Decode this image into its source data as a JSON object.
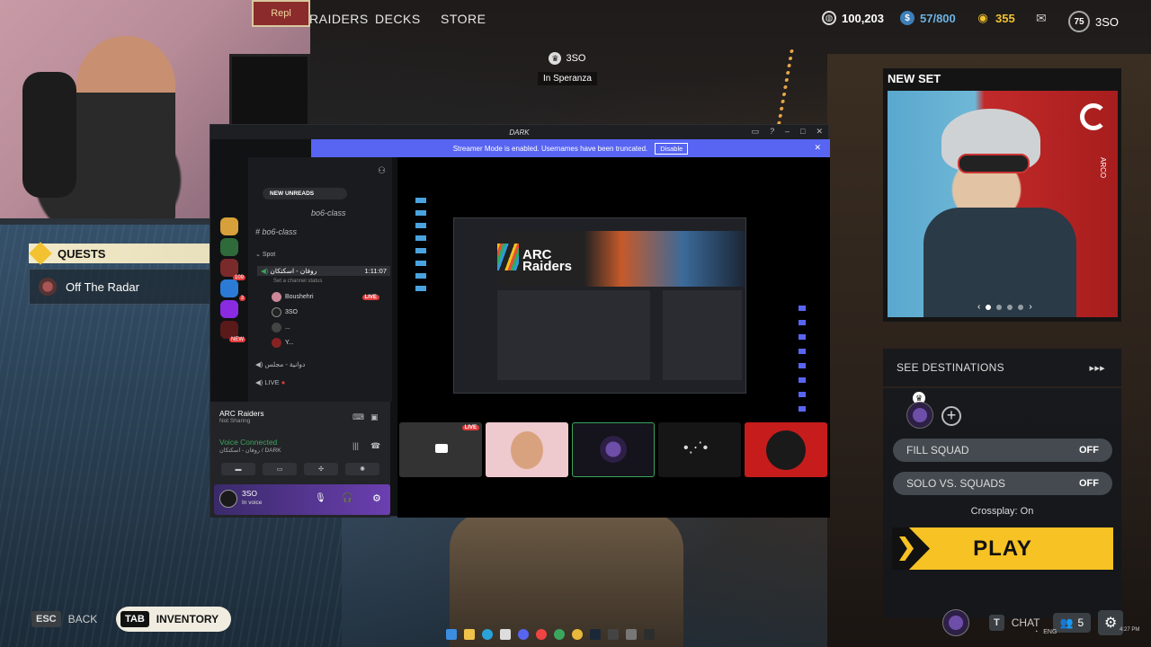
{
  "nav": {
    "items": [
      "RAIDERS",
      "DECKS",
      "STORE"
    ],
    "coins": "100,203",
    "cred": "57/800",
    "tokens": "355",
    "level": "75",
    "username": "3SO"
  },
  "webcam": {
    "sign_text": "Repl"
  },
  "quests": {
    "title": "QUESTS",
    "item": "Off The Radar"
  },
  "player_tag": {
    "name": "3SO",
    "location": "In Speranza"
  },
  "discord": {
    "window_title": "DARK",
    "banner_text": "Streamer Mode is enabled. Usernames have been truncated.",
    "banner_button": "Disable",
    "new_unreads": "NEW UNREADS",
    "channel_1": "bo6-class",
    "channel_2": "bo6-class",
    "category": "Spot",
    "voice_channel": "روفان - اسكتكان",
    "voice_timer": "1:11:07",
    "set_status": "Set a channel status",
    "voice_users": [
      {
        "name": "Boushehri",
        "live": "LIVE"
      },
      {
        "name": "3SO",
        "live": ""
      },
      {
        "name": "...",
        "live": ""
      },
      {
        "name": "Y...",
        "live": ""
      }
    ],
    "channel_3": "دوانية - مجلس",
    "channel_4": "LIVE",
    "guild_badges": [
      "109",
      "3",
      "NEW"
    ],
    "stream_activity": "ARC Raiders",
    "stream_sub": "Not Sharing",
    "voice_status": "Voice Connected",
    "voice_server": "روفان - اسكتكان / DARK",
    "user_name": "3SO",
    "user_status": "In voice",
    "thumb_live": "LIVE",
    "game_title_line1": "ARC",
    "game_title_line2": "Raiders"
  },
  "right_panel": {
    "new_set_title": "NEW SET",
    "brand": "ARCO",
    "see_destinations": "SEE DESTINATIONS",
    "fill_squad": "FILL SQUAD",
    "fill_squad_value": "OFF",
    "solo_vs_squads": "SOLO VS. SQUADS",
    "solo_value": "OFF",
    "crossplay": "Crossplay: On",
    "play": "PLAY"
  },
  "bottom": {
    "esc_key": "ESC",
    "back": "BACK",
    "tab_key": "TAB",
    "inventory": "INVENTORY",
    "t_key": "T",
    "chat": "CHAT",
    "party_count": "5"
  },
  "tray": {
    "lang": "ENG",
    "time": "4:27 PM"
  },
  "colors": {
    "accent_yellow": "#f7c223",
    "discord_purple": "#5865f2",
    "live_red": "#e03b3b"
  }
}
